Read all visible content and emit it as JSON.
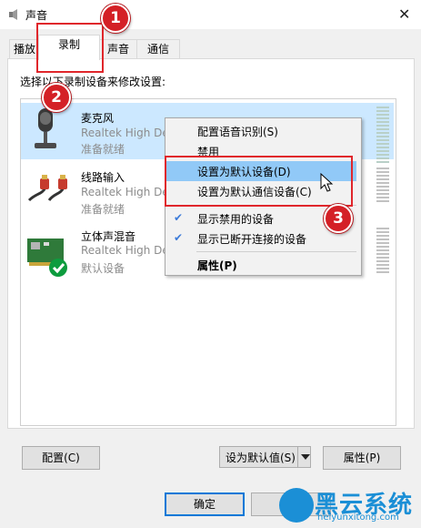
{
  "window": {
    "title": "声音",
    "close_glyph": "✕"
  },
  "tabs": [
    {
      "label": "播放"
    },
    {
      "label": "录制"
    },
    {
      "label": "声音"
    },
    {
      "label": "通信"
    }
  ],
  "instruction": "选择以下录制设备来修改设置:",
  "devices": [
    {
      "name": "麦克风",
      "driver": "Realtek High De",
      "status": "准备就绪",
      "icon": "microphone-icon"
    },
    {
      "name": "线路输入",
      "driver": "Realtek High De",
      "status": "准备就绪",
      "icon": "line-in-icon"
    },
    {
      "name": "立体声混音",
      "driver": "Realtek High De",
      "status": "默认设备",
      "icon": "sound-card-icon"
    }
  ],
  "context_menu": {
    "items": [
      {
        "label": "配置语音识别(S)"
      },
      {
        "label": "禁用"
      },
      {
        "label": "设置为默认设备(D)"
      },
      {
        "label": "设置为默认通信设备(C)"
      },
      {
        "label": "显示禁用的设备",
        "checked": true
      },
      {
        "label": "显示已断开连接的设备",
        "checked": true
      },
      {
        "label": "属性(P)"
      }
    ]
  },
  "annotations": [
    "1",
    "2",
    "3"
  ],
  "buttons": {
    "configure": "配置(C)",
    "set_default": "设为默认值(S)",
    "properties": "属性(P)",
    "ok": "确定",
    "cancel": "取消"
  },
  "watermark": {
    "title": "黑云系统",
    "url": "heiyunxitong.com"
  },
  "colors": {
    "selection": "#cce8ff",
    "menu_highlight": "#91c9f7",
    "annotation_red": "#e0262b",
    "watermark_blue": "#1b8fd6"
  }
}
